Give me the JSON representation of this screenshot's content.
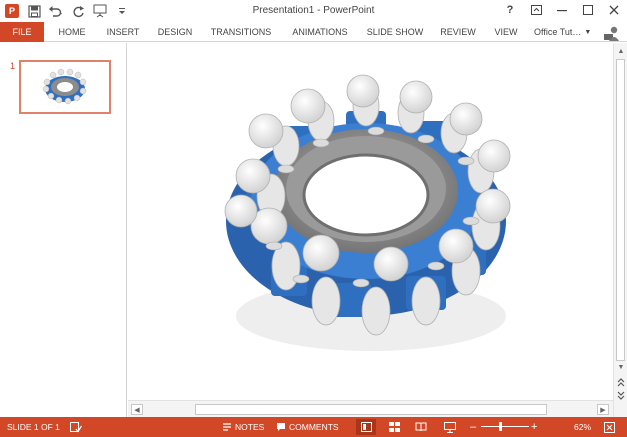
{
  "window": {
    "title": "Presentation1 - PowerPoint",
    "app_icon": "P",
    "controls": {
      "help": "?"
    }
  },
  "ribbon": {
    "tabs": {
      "file": "FILE",
      "home": "HOME",
      "insert": "INSERT",
      "design": "DESIGN",
      "transitions": "TRANSITIONS",
      "animations": "ANIMATIONS",
      "slideshow": "SLIDE SHOW",
      "review": "REVIEW",
      "view": "VIEW"
    },
    "account": "Office Tut…"
  },
  "thumbnails": [
    {
      "number": "1"
    }
  ],
  "statusbar": {
    "slide_info": "SLIDE 1 OF 1",
    "notes": "NOTES",
    "comments": "COMMENTS",
    "zoom": "62%",
    "zoom_level": 0.62
  },
  "icons": [
    "app-icon",
    "save-icon",
    "undo-icon",
    "redo-icon",
    "presenter-icon",
    "customize-icon",
    "help-icon",
    "ribbon-display-icon",
    "minimize-icon",
    "maximize-icon",
    "close-icon",
    "spelling-icon",
    "notes-icon",
    "comments-icon",
    "normal-view-icon",
    "slide-sorter-icon",
    "reading-view-icon",
    "slideshow-icon",
    "zoom-out-icon",
    "zoom-in-icon",
    "fit-slide-icon"
  ],
  "colors": {
    "accent": "#d24726",
    "gear": "#2e6fc0",
    "ring": "#8c8c8c"
  }
}
